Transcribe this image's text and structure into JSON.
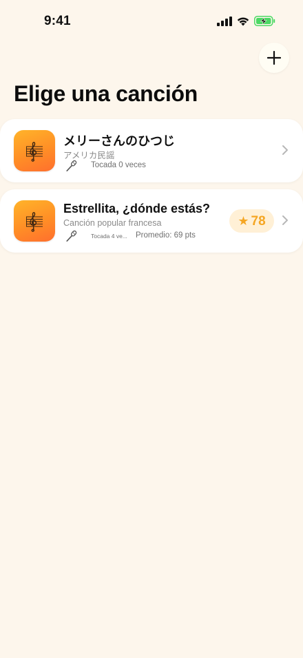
{
  "status_bar": {
    "time": "9:41"
  },
  "header": {
    "add_label": "+",
    "title": "Elige una canción"
  },
  "songs": [
    {
      "title": "メリーさんのひつじ",
      "artist": "アメリカ民謡",
      "play_count": "Tocada 0 veces"
    },
    {
      "title": "Estrellita, ¿dónde estás?",
      "artist": "Canción popular francesa",
      "play_count": "Tocada 4 ve...",
      "average": "Promedio: 69 pts",
      "score": "78",
      "score_star": "★"
    }
  ],
  "colors": {
    "background": "#FDF6EC",
    "accent": "#F5A623",
    "thumb_gradient": [
      "#FFB42A",
      "#FF6F2E"
    ]
  },
  "icons": {
    "status": [
      "signal-icon",
      "wifi-icon",
      "battery-charging-icon"
    ],
    "card": [
      "sheet-music-icon",
      "microphone-icon",
      "chevron-right-icon"
    ]
  }
}
